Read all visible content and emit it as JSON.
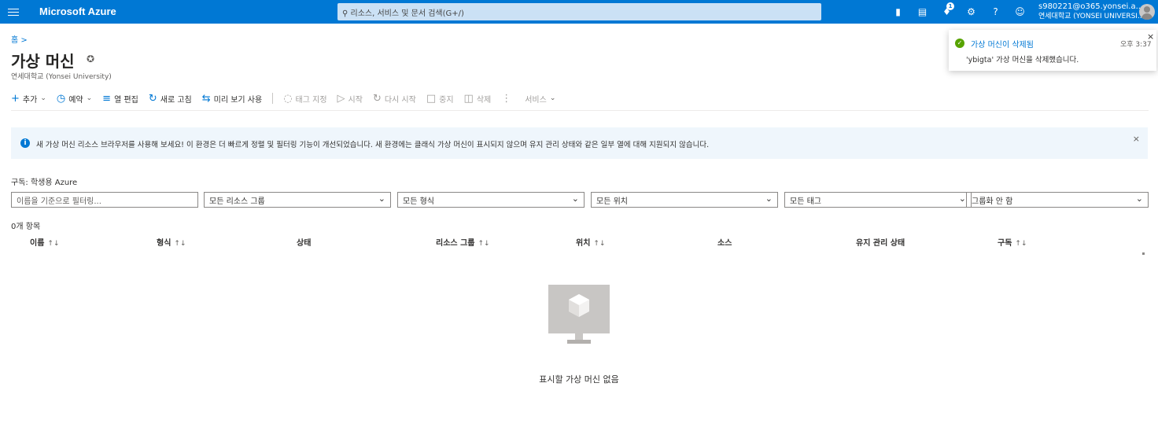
{
  "topbar": {
    "brand": "Microsoft Azure",
    "search_placeholder": "리소스, 서비스 및 문서 검색(G+/)",
    "notification_count": "1",
    "account_email": "s980221@o365.yonsei.a...",
    "account_org": "연세대학교 (YONSEI UNIVERSI..."
  },
  "breadcrumb": "홈 >",
  "page": {
    "title": "가상 머신",
    "subtitle": "연세대학교 (Yonsei University)"
  },
  "toolbar": {
    "add": "추가",
    "reservation": "예약",
    "edit_columns": "열 편집",
    "refresh": "새로 고침",
    "try_preview": "미리 보기 사용",
    "assign_tags": "태그 지정",
    "start": "시작",
    "restart": "다시 시작",
    "stop": "중지",
    "delete": "삭제",
    "services": "서비스"
  },
  "infobar": {
    "text": "새 가상 머신 리소스 브라우저를 사용해 보세요! 이 환경은 더 빠르게 정렬 및 필터링 기능이 개선되었습니다. 새 환경에는 클래식 가상 머신이 표시되지 않으며 유지 관리 상태와 같은 일부 열에 대해 지원되지 않습니다."
  },
  "filters": {
    "subscription_label": "구독: 학생용 Azure",
    "name_placeholder": "이름을 기준으로 필터링...",
    "resource_group": "모든 리소스 그룹",
    "type": "모든 형식",
    "location": "모든 위치",
    "tags": "모든 태그",
    "grouping": "그룹화 안 함"
  },
  "list": {
    "count": "0개 항목",
    "columns": [
      "이름",
      "형식",
      "상태",
      "리소스 그룹",
      "위치",
      "소스",
      "유지 관리 상태",
      "구독"
    ],
    "sortable": [
      true,
      true,
      false,
      true,
      true,
      false,
      false,
      true
    ],
    "empty_text": "표시할 가상 머신 없음"
  },
  "toast": {
    "title": "가상 머신이 삭제됨",
    "time": "오후 3:37",
    "message": "'ybigta' 가상 머신을 삭제했습니다."
  },
  "colors": {
    "topbar": "#0078d4",
    "search": "#cbe1f5",
    "infobar": "#eff6fc",
    "success": "#57a300"
  }
}
